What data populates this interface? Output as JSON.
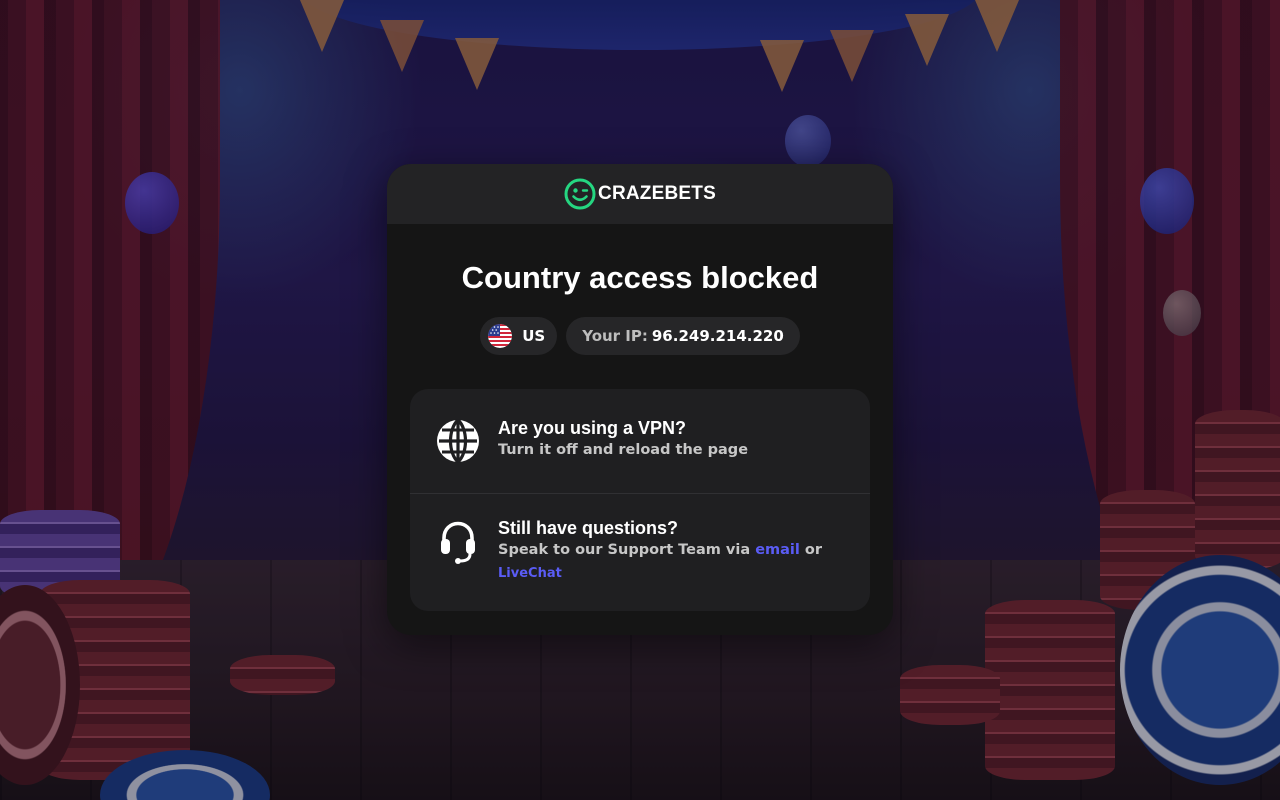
{
  "brand": {
    "name": "CRAZEBETS",
    "logo_icon": "smiley-face-icon",
    "accent": "#25d681"
  },
  "title": "Country access blocked",
  "location": {
    "flag_icon": "us-flag-icon",
    "country_code": "US",
    "ip_label": "Your IP:",
    "ip_value": "96.249.214.220"
  },
  "vpn_notice": {
    "icon": "globe-icon",
    "title": "Are you using a VPN?",
    "subtitle": "Turn it off and reload the page"
  },
  "support": {
    "icon": "headset-icon",
    "title": "Still have questions?",
    "text_prefix": "Speak to our Support Team via",
    "email_link": "email",
    "connector": "or",
    "livechat_link": "LiveChat",
    "link_color": "#5a5cf5"
  }
}
